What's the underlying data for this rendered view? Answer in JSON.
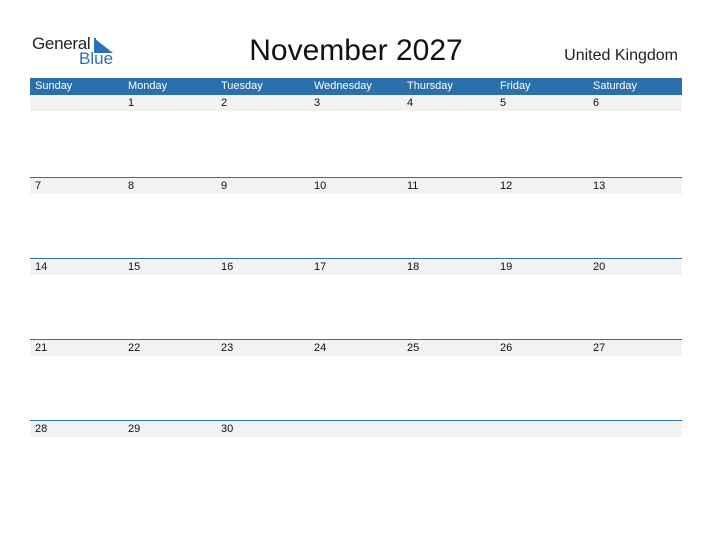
{
  "logo": {
    "general": "General",
    "blue": "Blue"
  },
  "title": "November 2027",
  "country": "United Kingdom",
  "colors": {
    "accent": "#2b6fad",
    "strip": "#f2f2f2"
  },
  "weekdays": [
    "Sunday",
    "Monday",
    "Tuesday",
    "Wednesday",
    "Thursday",
    "Friday",
    "Saturday"
  ],
  "weeks": [
    [
      "",
      "1",
      "2",
      "3",
      "4",
      "5",
      "6"
    ],
    [
      "7",
      "8",
      "9",
      "10",
      "11",
      "12",
      "13"
    ],
    [
      "14",
      "15",
      "16",
      "17",
      "18",
      "19",
      "20"
    ],
    [
      "21",
      "22",
      "23",
      "24",
      "25",
      "26",
      "27"
    ],
    [
      "28",
      "29",
      "30",
      "",
      "",
      "",
      ""
    ]
  ]
}
